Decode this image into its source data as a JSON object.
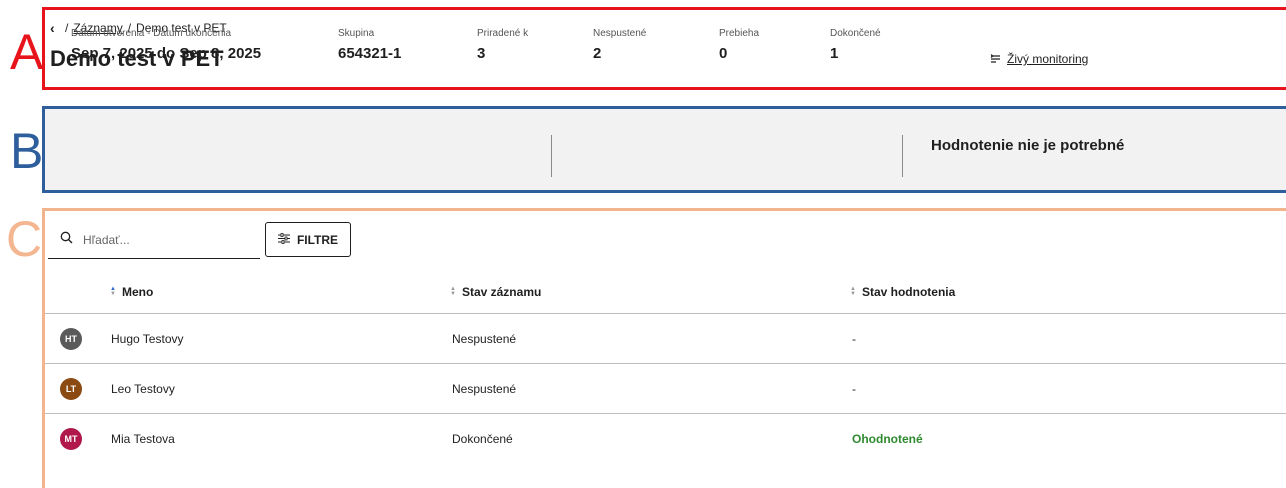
{
  "annotations": {
    "a": "A",
    "b": "B",
    "c": "C"
  },
  "breadcrumb": {
    "back_icon": "chevron-left-icon",
    "sep1": "/",
    "link": "Záznamy",
    "sep2": "/",
    "current": "Demo test v PET"
  },
  "header": {
    "title": "Demo test v PET",
    "live_icon": "list-icon",
    "live_label": "Živý monitoring"
  },
  "stats": {
    "dates": {
      "label": "Dátum otvorenia - Dátum ukončenia",
      "value": "Sep 7, 2025 do Sep 8, 2025"
    },
    "group": {
      "label": "Skupina",
      "value": "654321-1"
    },
    "assigned": {
      "label": "Priradené k",
      "value": "3"
    },
    "not_started": {
      "label": "Nespustené",
      "value": "2"
    },
    "in_progress": {
      "label": "Prebieha",
      "value": "0"
    },
    "completed": {
      "label": "Dokončené",
      "value": "1"
    },
    "evaluation_note": "Hodnotenie nie je potrebné"
  },
  "toolbar": {
    "search_placeholder": "Hľadať...",
    "search_icon": "search-icon",
    "filter_icon": "sliders-icon",
    "filter_label": "FILTRE"
  },
  "table": {
    "columns": [
      "Meno",
      "Stav záznamu",
      "Stav hodnotenia"
    ],
    "rows": [
      {
        "initials": "HT",
        "name": "Hugo Testovy",
        "status": "Nespustené",
        "evaluation": "-",
        "avatar_color": "#5a5a5a"
      },
      {
        "initials": "LT",
        "name": "Leo Testovy",
        "status": "Nespustené",
        "evaluation": "-",
        "avatar_color": "#8a4a12"
      },
      {
        "initials": "MT",
        "name": "Mia Testova",
        "status": "Dokončené",
        "evaluation": "Ohodnotené",
        "avatar_color": "#b0174a"
      }
    ]
  },
  "colors": {
    "frame_a": "#e8141c",
    "frame_b": "#2e5f9c",
    "frame_c": "#f2b48c",
    "evaluated": "#2f8a2f",
    "sort_active": "#2e6ad1"
  }
}
